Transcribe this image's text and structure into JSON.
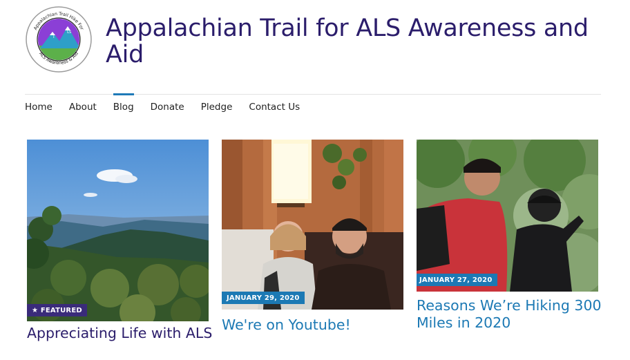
{
  "site": {
    "title": "Appalachian Trail for ALS Awareness and Aid",
    "logo": {
      "top_text": "Appalachian Trail Hike For",
      "bottom_text": "ALS Awareness & Aid",
      "mark_letters": [
        "T",
        "L",
        "S"
      ]
    }
  },
  "nav": {
    "items": [
      {
        "label": "Home",
        "active": false
      },
      {
        "label": "About",
        "active": false
      },
      {
        "label": "Blog",
        "active": true
      },
      {
        "label": "Donate",
        "active": false
      },
      {
        "label": "Pledge",
        "active": false
      },
      {
        "label": "Contact Us",
        "active": false
      }
    ]
  },
  "posts": [
    {
      "title": "Appreciating Life with ALS",
      "badge": "★ FEATURED",
      "image": "mountain-vista"
    },
    {
      "title": "We're on Youtube!",
      "badge": "JANUARY 29, 2020",
      "image": "couple-indoors"
    },
    {
      "title": "Reasons We’re Hiking 300 Miles in 2020",
      "badge": "JANUARY 27, 2020",
      "image": "hikers-forest"
    }
  ],
  "colors": {
    "title": "#2b1d6b",
    "link": "#1c79b4",
    "featured_badge": "#3a2b7a",
    "date_badge": "#1c79b4",
    "nav_active": "#1f7ab8"
  }
}
